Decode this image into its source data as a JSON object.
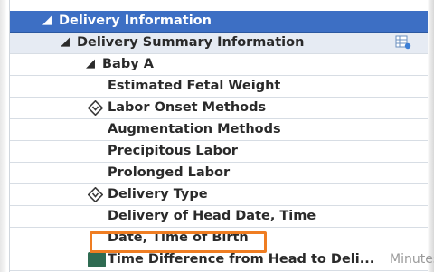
{
  "tree": {
    "header": "Delivery Information",
    "summary": "Delivery Summary Information",
    "baby": "Baby A",
    "items": [
      "Estimated Fetal Weight",
      "Labor Onset Methods",
      "Augmentation Methods",
      "Precipitous Labor",
      "Prolonged Labor",
      "Delivery Type",
      "Delivery of Head Date, Time",
      "Date, Time of Birth",
      "Time Difference from Head to Deli..."
    ],
    "last_unit": "Minutes"
  },
  "colors": {
    "header_bg": "#3d6fc4",
    "highlight": "#ef7d22"
  },
  "icons": {
    "expand": "collapse-triangle-icon",
    "diamond": "diamond-arrow-icon",
    "grid": "grid-settings-icon",
    "calc": "calculator-icon"
  }
}
